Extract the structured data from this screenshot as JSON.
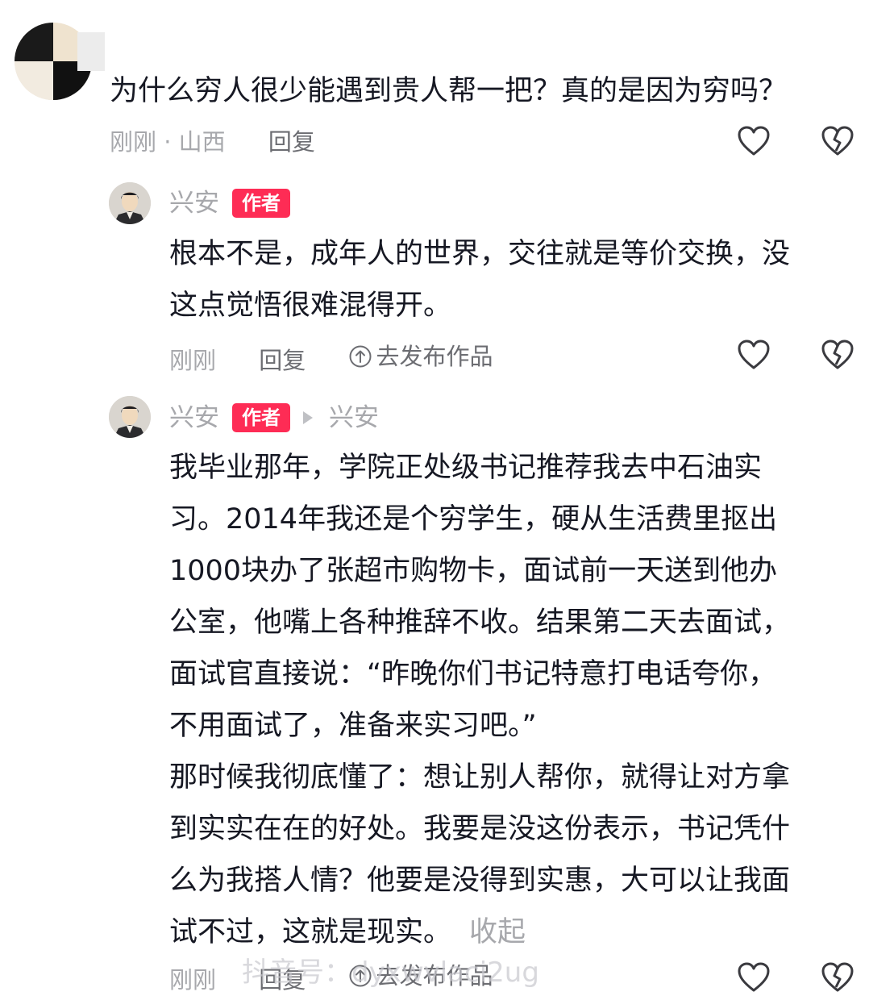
{
  "question": {
    "text": "为什么穷人很少能遇到贵人帮一把？真的是因为穷吗？",
    "time": "刚刚",
    "location_sep": " · ",
    "location": "山西",
    "reply_label": "回复"
  },
  "reply1": {
    "author": "兴安",
    "badge": "作者",
    "lines": [
      "根本不是，成年人的世界，交往就是等价交换，没",
      "这点觉悟很难混得开。"
    ],
    "time": "刚刚",
    "reply_label": "回复",
    "publish_label": "去发布作品"
  },
  "reply2": {
    "author": "兴安",
    "badge": "作者",
    "reply_to": "兴安",
    "lines": [
      "我毕业那年，学院正处级书记推荐我去中石油实",
      "习。2014年我还是个穷学生，硬从生活费里抠出",
      "1000块办了张超市购物卡，面试前一天送到他办",
      "公室，他嘴上各种推辞不收。结果第二天去面试，",
      "面试官直接说：“昨晚你们书记特意打电话夸你，",
      "不用面试了，准备来实习吧。”",
      "那时候我彻底懂了：想让别人帮你，就得让对方拿",
      "到实实在在的好处。我要是没这份表示，书记凭什",
      "么为我搭人情？他要是没得到实惠，大可以让我面",
      "试不过，这就是现实。"
    ],
    "collapse_label": "收起",
    "time": "刚刚",
    "reply_label": "回复",
    "publish_label": "去发布作品"
  },
  "watermark": "抖音号：dyxwvlaci2ug",
  "icons": {
    "like": "heart-outline-icon",
    "dislike": "broken-heart-icon",
    "publish": "upload-circle-icon"
  },
  "colors": {
    "badge": "#fe2c55",
    "meta_gray": "#a7a8ac",
    "text": "#161823"
  }
}
